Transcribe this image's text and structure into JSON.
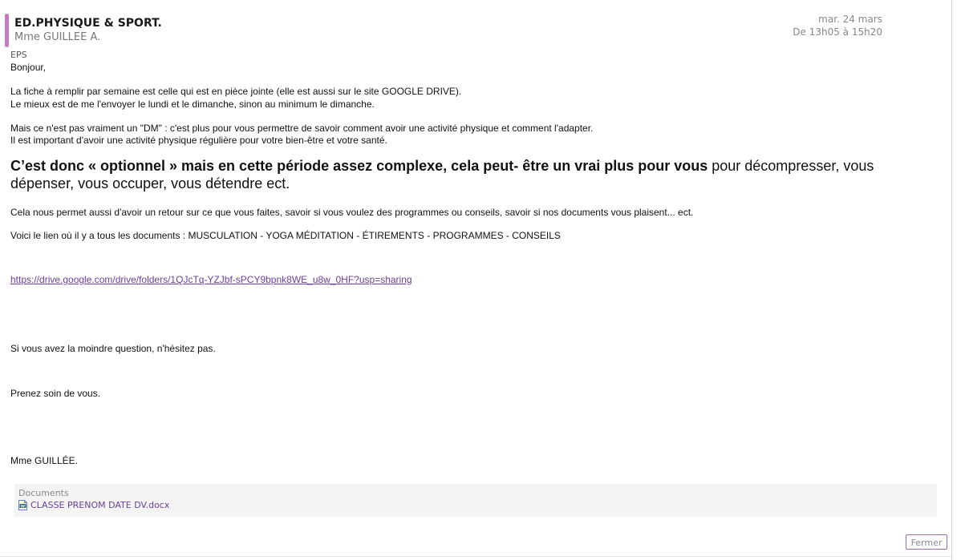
{
  "header": {
    "subject": "ED.PHYSIQUE & SPORT.",
    "teacher": "Mme GUILLEE A.",
    "date": "mar. 24 mars",
    "time": "De 13h05 à 15h20",
    "accent_color": "#c57bbd"
  },
  "message": {
    "category": "EPS",
    "greeting": "Bonjour,",
    "para1_line1": "La fiche à remplir par semaine est celle qui est en pièce jointe (elle est aussi sur le site GOOGLE DRIVE).",
    "para1_line2": "Le mieux est de me l'envoyer le lundi et le dimanche, sinon au minimum le dimanche.",
    "para2_line1": "Mais ce n'est pas vraiment un \"DM\" : c'est plus pour vous permettre de savoir comment avoir une activité physique et comment l'adapter.",
    "para2_line2": "Il est important d'avoir une activité physique régulière pour votre bien-être et votre santé.",
    "emphasis_bold": "C’est donc « optionnel » mais en cette période assez complexe, cela peut- être un vrai plus pour vous",
    "emphasis_normal": " pour décompresser, vous dépenser, vous occuper, vous détendre ect.",
    "para3": "Cela nous permet aussi d'avoir un retour sur ce que vous faites, savoir si vous voulez des programmes ou conseils, savoir si nos documents vous plaisent... ect.",
    "para4": "Voici le lien où il y a tous les documents : MUSCULATION - YOGA MÉDITATION - ÉTIREMENTS - PROGRAMMES - CONSEILS",
    "link": "https://drive.google.com/drive/folders/1QJcTq-YZJbf-sPCY9bpnk8WE_u8w_0HF?usp=sharing",
    "question": "Si vous avez la moindre question, n'hésitez pas.",
    "take_care": "Prenez soin de vous.",
    "signature": "Mme GUILLÉE."
  },
  "documents": {
    "title": "Documents",
    "items": [
      {
        "name": "CLASSE PRENOM DATE DV.docx",
        "icon": "word-doc-icon"
      }
    ]
  },
  "actions": {
    "close_label": "Fermer"
  }
}
